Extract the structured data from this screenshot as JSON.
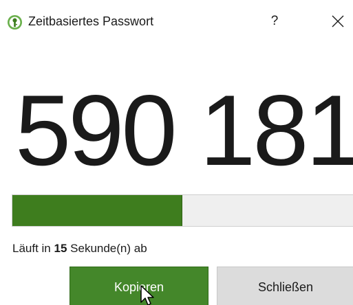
{
  "window": {
    "title": "Zeitbasiertes Passwort",
    "icon": "keepassxc-logo-icon",
    "help_label": "?",
    "close_icon": "close-icon"
  },
  "totp": {
    "code": "590 181",
    "progress_fraction": 0.485,
    "status_prefix": "Läuft in ",
    "seconds": "15",
    "status_suffix": " Sekunde(n) ab"
  },
  "buttons": {
    "copy_label": "Kopieren",
    "close_label": "Schließen"
  },
  "colors": {
    "accent_green": "#44872a",
    "progress_green": "#3e7d1e",
    "progress_track": "#efefef",
    "secondary_button": "#dcdcdc"
  }
}
